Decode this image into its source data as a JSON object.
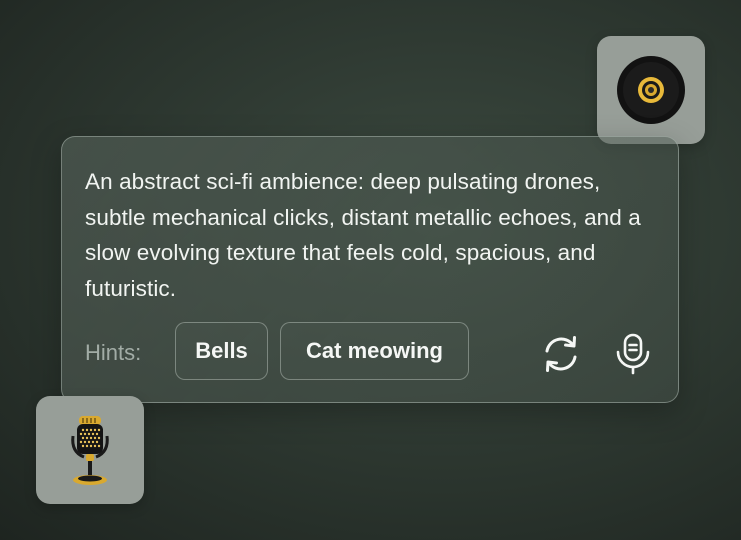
{
  "prompt": {
    "text": "An abstract sci-fi ambience: deep pulsating drones, subtle mechanical clicks, distant metallic echoes, and a slow evolving texture that feels cold, spacious, and futuristic."
  },
  "hints": {
    "label": "Hints:",
    "chips": [
      "Bells",
      "Cat meowing"
    ]
  },
  "actions": {
    "refresh_icon": "refresh-icon",
    "mic_icon": "microphone-icon"
  },
  "decorations": {
    "top_tile_icon": "speaker-icon",
    "bottom_tile_icon": "vintage-microphone-icon"
  },
  "colors": {
    "background": "#1f2622",
    "card_border": "#c8d4cc",
    "text_primary": "#f1f4f1",
    "text_secondary": "#a2aca6",
    "tile_bg": "#979e98",
    "accent_gold": "#e8b93a"
  }
}
